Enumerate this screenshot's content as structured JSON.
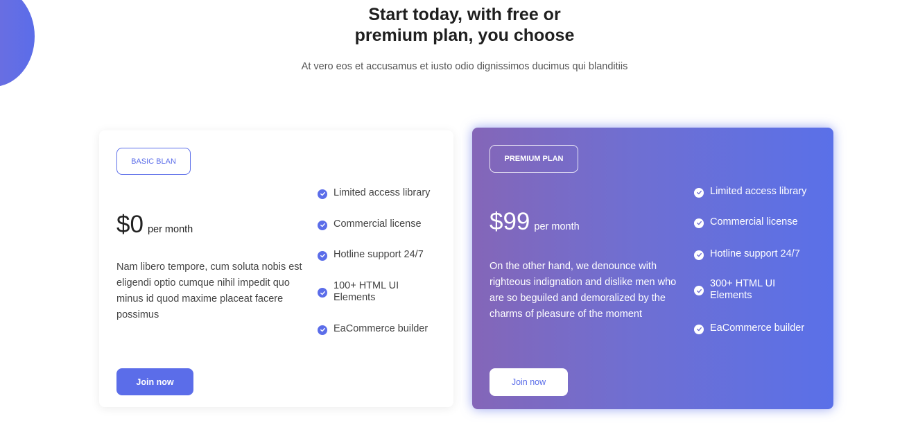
{
  "header": {
    "title_line1": "Start today, with free or",
    "title_line2": "premium plan, you choose",
    "subtitle": "At vero eos et accusamus et iusto odio dignissimos ducimus qui blanditiis"
  },
  "colors": {
    "accent": "#5b6de9",
    "premium_gradient_start": "#8466b8",
    "premium_gradient_end": "#5a70e8"
  },
  "plans": [
    {
      "badge": "BASIC BLAN",
      "price": "$0",
      "period": "per month",
      "description": "Nam libero tempore, cum soluta nobis est eligendi optio cumque nihil impedit quo minus id quod maxime placeat facere possimus",
      "features": [
        "Limited access library",
        "Commercial license",
        "Hotline support 24/7",
        "100+ HTML UI Elements",
        "EaCommerce builder"
      ],
      "cta": "Join now",
      "feature_icon": "check-circle-icon"
    },
    {
      "badge": "PREMIUM PLAN",
      "price": "$99",
      "period": "per month",
      "description": "On the other hand, we denounce with righteous indignation and dislike men who are so beguiled and demoralized by the charms of pleasure of the moment",
      "features": [
        "Limited access library",
        "Commercial license",
        "Hotline support 24/7",
        "300+ HTML UI Elements",
        "EaCommerce builder"
      ],
      "cta": "Join now",
      "feature_icon": "check-circle-icon"
    }
  ]
}
